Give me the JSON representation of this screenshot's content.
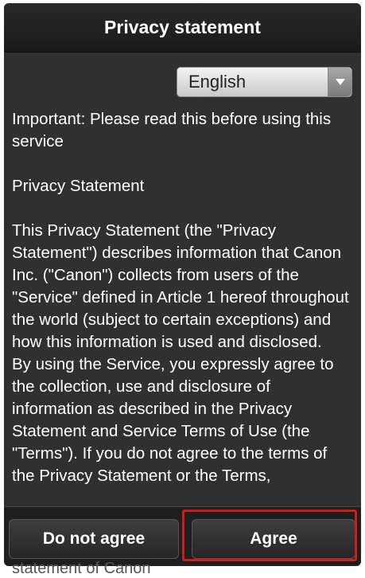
{
  "header": {
    "title": "Privacy statement"
  },
  "language": {
    "selected": "English"
  },
  "content": {
    "p1": "Important: Please read this before using this service",
    "p2": "Privacy Statement",
    "p3": "This Privacy Statement (the \"Privacy Statement\") describes information that Canon Inc. (\"Canon\") collects from users of the \"Service\" defined in Article 1 hereof throughout the world (subject to certain exceptions) and how this information is used and disclosed.",
    "p4": "By using the Service, you expressly agree to the collection, use and disclosure of information as described in the Privacy Statement and Service Terms of Use (the \"Terms\"). If you do not agree to the terms of the Privacy Statement or the Terms,",
    "below": "statement of Canon"
  },
  "buttons": {
    "disagree": "Do not agree",
    "agree": "Agree"
  }
}
